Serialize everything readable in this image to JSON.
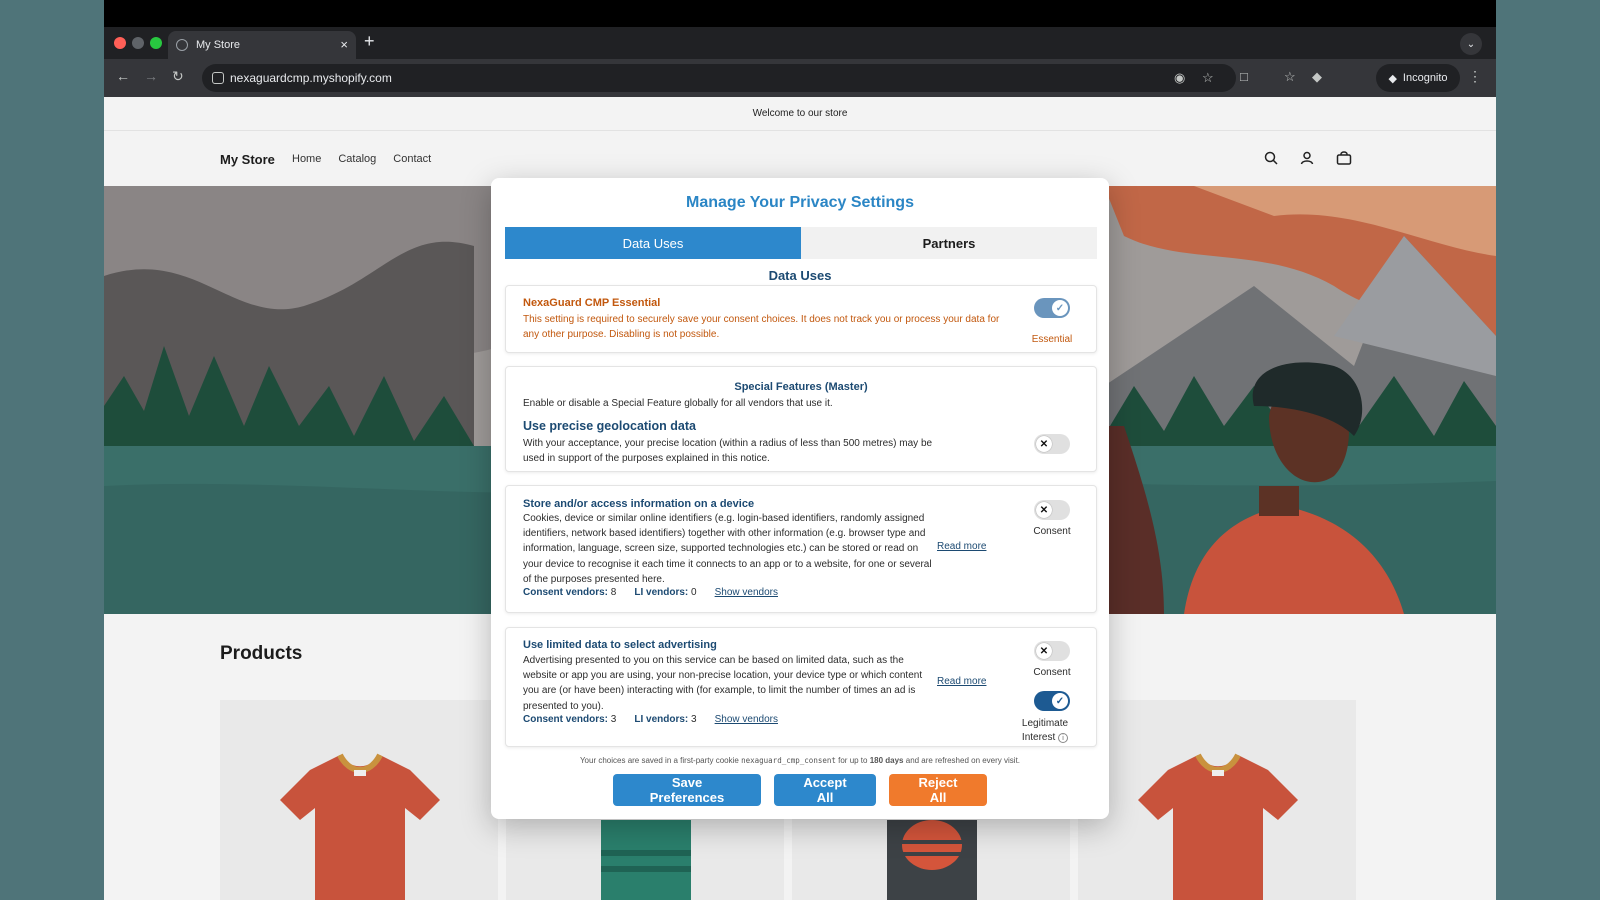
{
  "browser": {
    "tab_title": "My Store",
    "tab_close": "×",
    "new_tab": "+",
    "url": "nexaguardcmp.myshopify.com",
    "incognito_label": "Incognito"
  },
  "store": {
    "announcement": "Welcome to our store",
    "logo": "My Store",
    "nav": [
      "Home",
      "Catalog",
      "Contact"
    ],
    "products_heading": "Products"
  },
  "modal": {
    "title": "Manage Your Privacy Settings",
    "tabs": [
      "Data Uses",
      "Partners"
    ],
    "section_heading": "Data Uses",
    "essential": {
      "title": "NexaGuard CMP Essential",
      "description": "This setting is required to securely save your consent choices. It does not track you or process your data for any other purpose. Disabling is not possible.",
      "toggle_label": "Essential"
    },
    "special": {
      "heading": "Special Features (Master)",
      "description": "Enable or disable a Special Feature globally for all vendors that use it.",
      "feature_title": "Use precise geolocation data",
      "feature_description": "With your acceptance, your precise location (within a radius of less than 500 metres) may be used in support of the purposes explained in this notice."
    },
    "purposes": [
      {
        "title": "Store and/or access information on a device",
        "description": "Cookies, device or similar online identifiers (e.g. login-based identifiers, randomly assigned identifiers, network based identifiers) together with other information (e.g. browser type and information, language, screen size, supported technologies etc.) can be stored or read on your device to recognise it each time it connects to an app or to a website, for one or several of the purposes presented here.",
        "consent_vendors_label": "Consent vendors:",
        "consent_vendors": "8",
        "li_vendors_label": "LI vendors:",
        "li_vendors": "0",
        "show_vendors": "Show vendors",
        "read_more": "Read more",
        "consent_label": "Consent"
      },
      {
        "title": "Use limited data to select advertising",
        "description": "Advertising presented to you on this service can be based on limited data, such as the website or app you are using, your non-precise location, your device type or which content you are (or have been) interacting with (for example, to limit the number of times an ad is presented to you).",
        "consent_vendors_label": "Consent vendors:",
        "consent_vendors": "3",
        "li_vendors_label": "LI vendors:",
        "li_vendors": "3",
        "show_vendors": "Show vendors",
        "read_more": "Read more",
        "consent_label": "Consent",
        "li_label_1": "Legitimate",
        "li_label_2": "Interest"
      }
    ],
    "note_prefix": "Your choices are saved in a first-party cookie ",
    "note_cookie": "nexaguard_cmp_consent",
    "note_mid": " for up to ",
    "note_days": "180 days",
    "note_suffix": " and are refreshed on every visit.",
    "buttons": {
      "save": "Save Preferences",
      "accept": "Accept All",
      "reject": "Reject All"
    }
  },
  "colors": {
    "accent_blue": "#2d88cc",
    "heading_navy": "#1c4a72",
    "essential_orange": "#c2580e",
    "reject_orange": "#f07a2c"
  }
}
